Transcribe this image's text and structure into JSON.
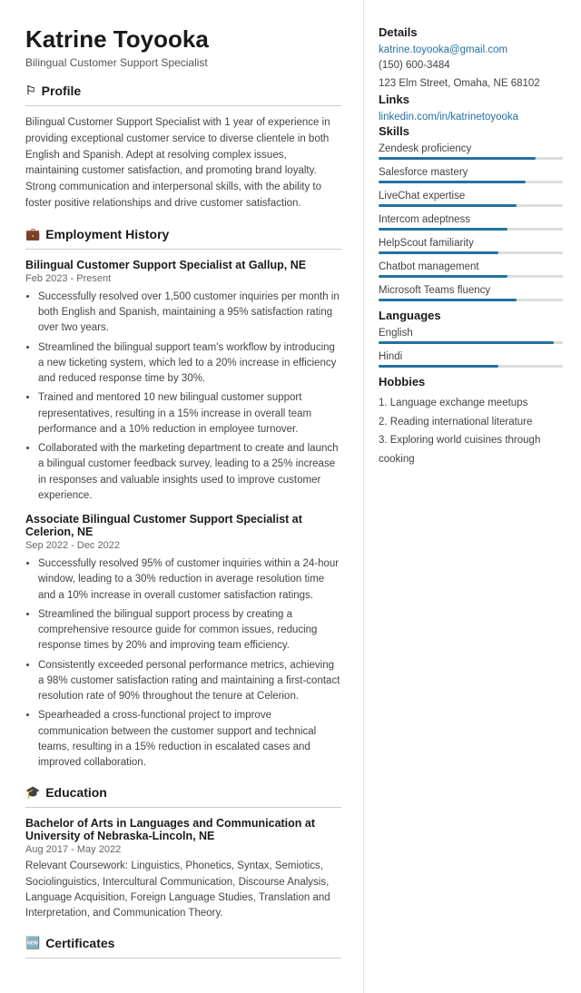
{
  "header": {
    "name": "Katrine Toyooka",
    "title": "Bilingual Customer Support Specialist"
  },
  "sections": {
    "profile": {
      "label": "Profile",
      "icon": "👤",
      "text": "Bilingual Customer Support Specialist with 1 year of experience in providing exceptional customer service to diverse clientele in both English and Spanish. Adept at resolving complex issues, maintaining customer satisfaction, and promoting brand loyalty. Strong communication and interpersonal skills, with the ability to foster positive relationships and drive customer satisfaction."
    },
    "employment": {
      "label": "Employment History",
      "icon": "🏢",
      "jobs": [
        {
          "title": "Bilingual Customer Support Specialist at Gallup, NE",
          "dates": "Feb 2023 - Present",
          "bullets": [
            "Successfully resolved over 1,500 customer inquiries per month in both English and Spanish, maintaining a 95% satisfaction rating over two years.",
            "Streamlined the bilingual support team's workflow by introducing a new ticketing system, which led to a 20% increase in efficiency and reduced response time by 30%.",
            "Trained and mentored 10 new bilingual customer support representatives, resulting in a 15% increase in overall team performance and a 10% reduction in employee turnover.",
            "Collaborated with the marketing department to create and launch a bilingual customer feedback survey, leading to a 25% increase in responses and valuable insights used to improve customer experience."
          ]
        },
        {
          "title": "Associate Bilingual Customer Support Specialist at Celerion, NE",
          "dates": "Sep 2022 - Dec 2022",
          "bullets": [
            "Successfully resolved 95% of customer inquiries within a 24-hour window, leading to a 30% reduction in average resolution time and a 10% increase in overall customer satisfaction ratings.",
            "Streamlined the bilingual support process by creating a comprehensive resource guide for common issues, reducing response times by 20% and improving team efficiency.",
            "Consistently exceeded personal performance metrics, achieving a 98% customer satisfaction rating and maintaining a first-contact resolution rate of 90% throughout the tenure at Celerion.",
            "Spearheaded a cross-functional project to improve communication between the customer support and technical teams, resulting in a 15% reduction in escalated cases and improved collaboration."
          ]
        }
      ]
    },
    "education": {
      "label": "Education",
      "icon": "🎓",
      "items": [
        {
          "title": "Bachelor of Arts in Languages and Communication at University of Nebraska-Lincoln, NE",
          "dates": "Aug 2017 - May 2022",
          "text": "Relevant Coursework: Linguistics, Phonetics, Syntax, Semiotics, Sociolinguistics, Intercultural Communication, Discourse Analysis, Language Acquisition, Foreign Language Studies, Translation and Interpretation, and Communication Theory."
        }
      ]
    },
    "certificates": {
      "label": "Certificates",
      "icon": "🏅"
    }
  },
  "right": {
    "details": {
      "label": "Details",
      "email": "katrine.toyooka@gmail.com",
      "phone": "(150) 600-3484",
      "address": "123 Elm Street, Omaha, NE 68102"
    },
    "links": {
      "label": "Links",
      "items": [
        {
          "text": "linkedin.com/in/katrinetoyooka",
          "url": "#"
        }
      ]
    },
    "skills": {
      "label": "Skills",
      "items": [
        {
          "name": "Zendesk proficiency",
          "level": 85
        },
        {
          "name": "Salesforce mastery",
          "level": 80
        },
        {
          "name": "LiveChat expertise",
          "level": 75
        },
        {
          "name": "Intercom adeptness",
          "level": 70
        },
        {
          "name": "HelpScout familiarity",
          "level": 65
        },
        {
          "name": "Chatbot management",
          "level": 70
        },
        {
          "name": "Microsoft Teams fluency",
          "level": 75
        }
      ]
    },
    "languages": {
      "label": "Languages",
      "items": [
        {
          "name": "English",
          "level": 95
        },
        {
          "name": "Hindi",
          "level": 65
        }
      ]
    },
    "hobbies": {
      "label": "Hobbies",
      "items": [
        "1. Language exchange meetups",
        "2. Reading international literature",
        "3. Exploring world cuisines through cooking"
      ]
    }
  }
}
